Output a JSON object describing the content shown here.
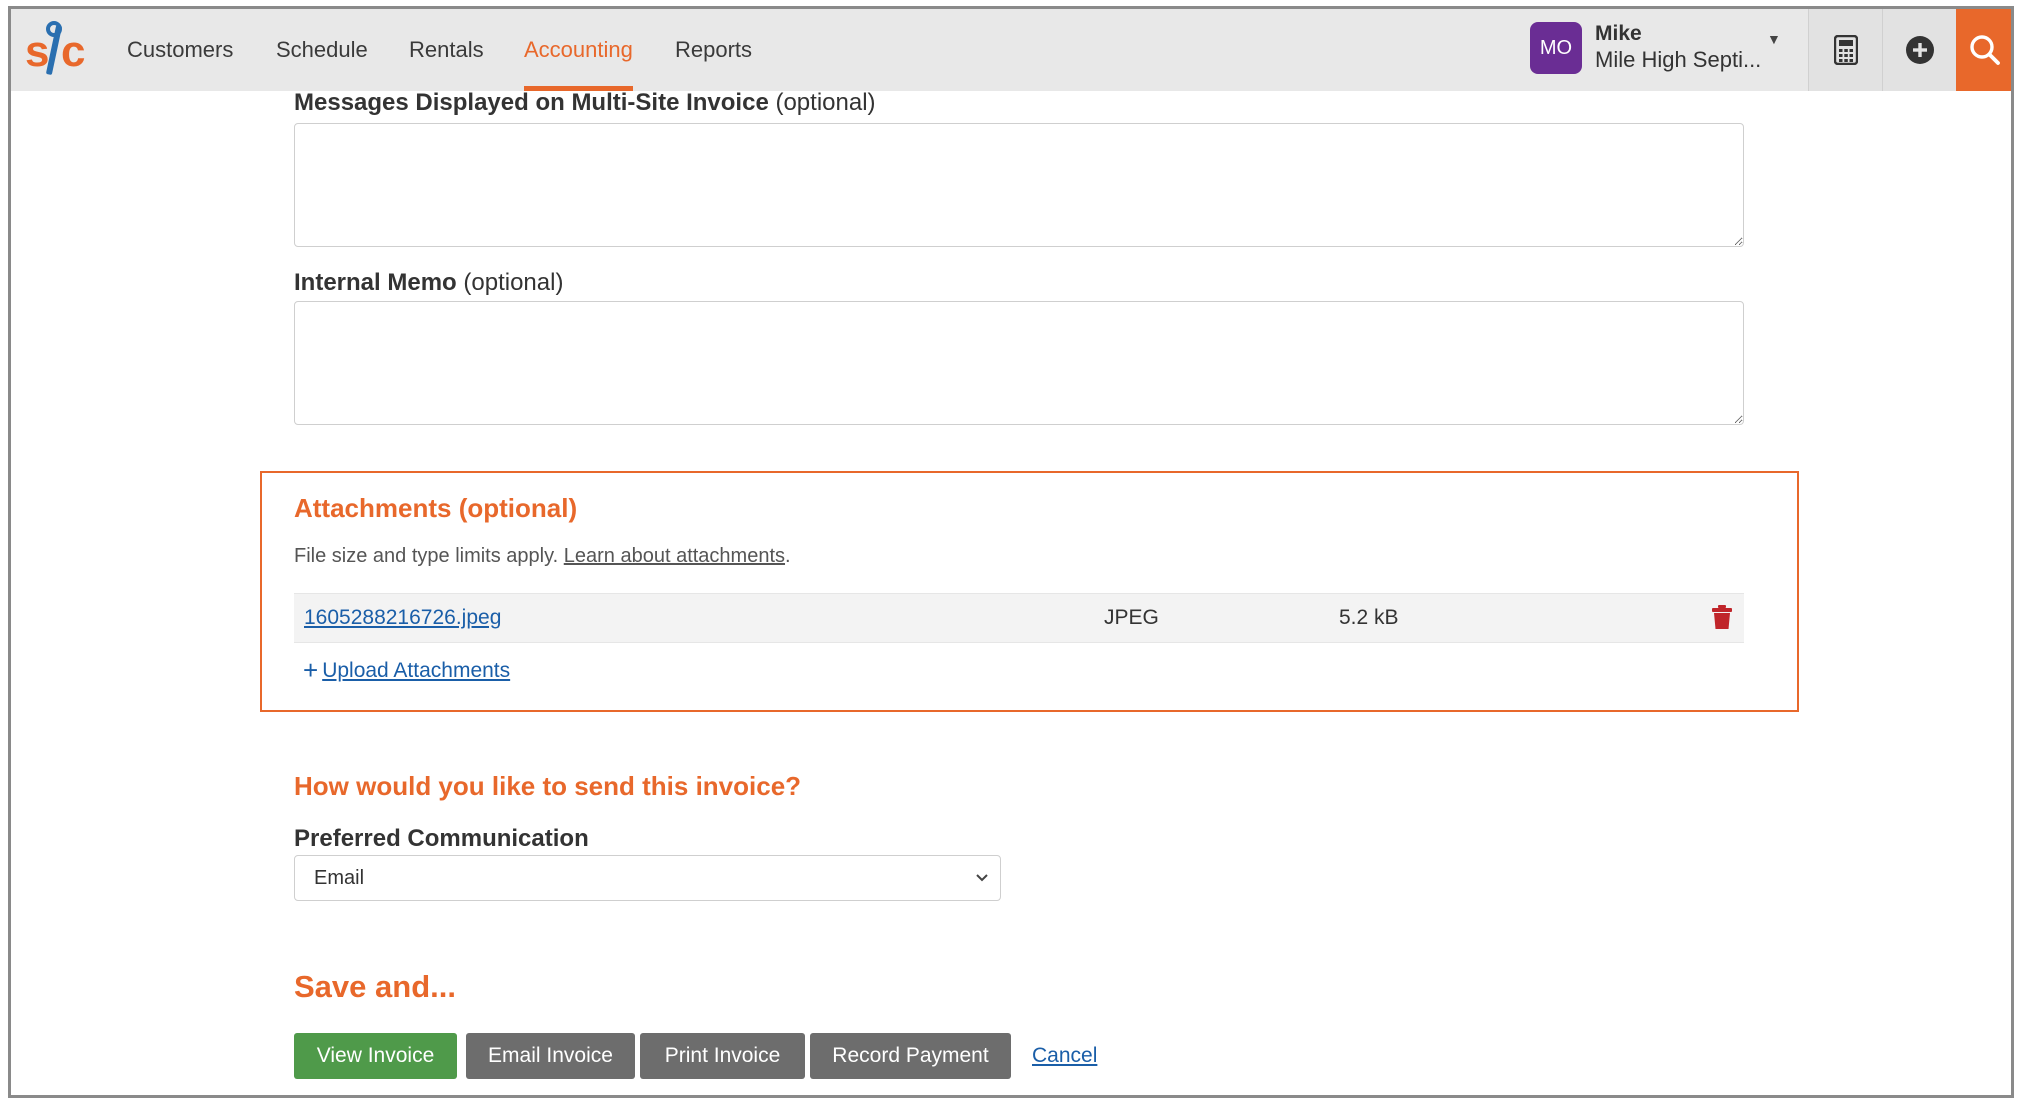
{
  "nav": {
    "items": [
      {
        "label": "Customers",
        "active": false
      },
      {
        "label": "Schedule",
        "active": false
      },
      {
        "label": "Rentals",
        "active": false
      },
      {
        "label": "Accounting",
        "active": true
      },
      {
        "label": "Reports",
        "active": false
      }
    ],
    "user": {
      "initials": "MO",
      "name": "Mike",
      "org": "Mile High Septi..."
    },
    "icons": [
      "calculator-icon",
      "plus-circle-icon",
      "search-icon"
    ]
  },
  "form": {
    "multisite_label": "Messages Displayed on Multi-Site Invoice",
    "multisite_optional": "(optional)",
    "multisite_value": "",
    "memo_label": "Internal Memo",
    "memo_optional": "(optional)",
    "memo_value": ""
  },
  "attachments": {
    "title": "Attachments (optional)",
    "help_prefix": "File size and type limits apply.",
    "help_link": "Learn about attachments",
    "help_suffix": ".",
    "files": [
      {
        "name": "1605288216726.jpeg",
        "type": "JPEG",
        "size": "5.2 kB"
      }
    ],
    "upload_label": "Upload Attachments"
  },
  "send": {
    "title": "How would you like to send this invoice?",
    "pref_label": "Preferred Communication",
    "pref_value": "Email"
  },
  "actions": {
    "title": "Save and...",
    "view": "View Invoice",
    "email": "Email Invoice",
    "print": "Print Invoice",
    "record": "Record Payment",
    "cancel": "Cancel"
  },
  "colors": {
    "accent": "#e8682b",
    "green": "#4f9a4a",
    "gray_button": "#6d6d6d",
    "link": "#1a5ea8",
    "avatar": "#6a2d94"
  }
}
